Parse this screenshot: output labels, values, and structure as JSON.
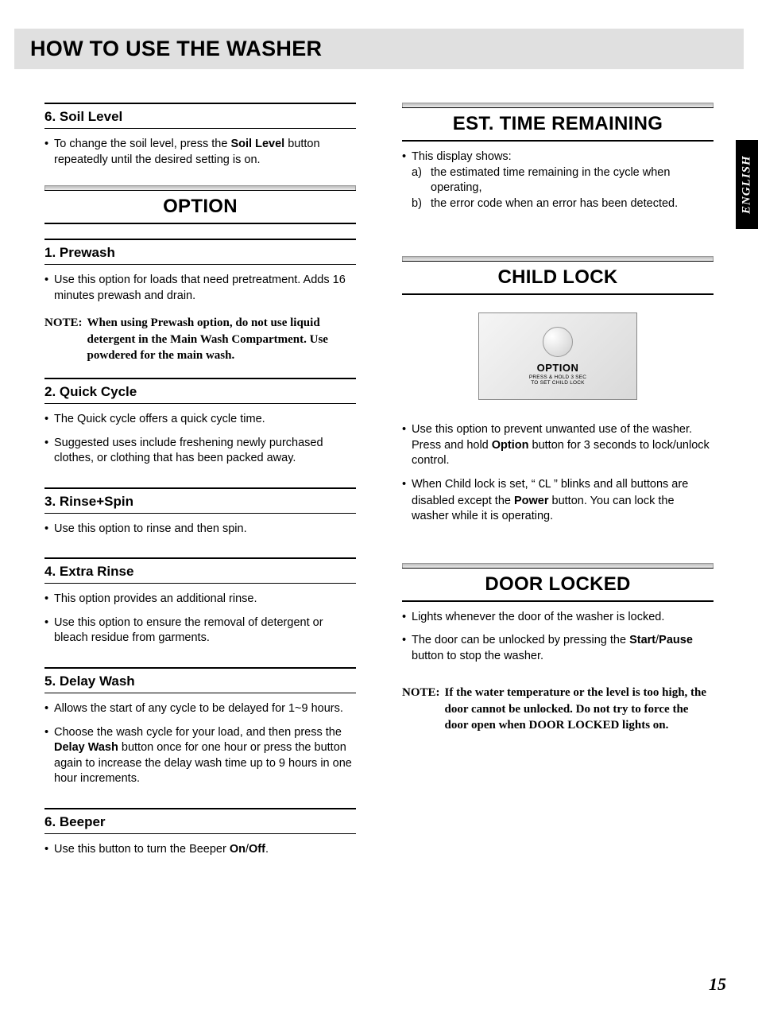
{
  "page_title": "HOW TO USE THE WASHER",
  "lang_tab": "ENGLISH",
  "page_number": "15",
  "left": {
    "soil": {
      "head": "6. Soil Level",
      "b1a": "To change the soil level, press the ",
      "b1b": "Soil Level",
      "b1c": " button repeatedly until the desired setting is on."
    },
    "option_section": "OPTION",
    "prewash": {
      "head": "1. Prewash",
      "b1": "Use this option for loads that need pretreatment. Adds 16 minutes prewash and drain.",
      "note_lbl": "NOTE:",
      "note_body": "When using Prewash option, do not use liquid detergent in the Main Wash Compartment. Use powdered for the main wash."
    },
    "quick": {
      "head": "2. Quick Cycle",
      "b1": "The Quick cycle offers a quick cycle time.",
      "b2": "Suggested uses include freshening newly purchased clothes, or clothing that has been packed away."
    },
    "rinsespin": {
      "head": "3. Rinse+Spin",
      "b1": "Use this option to rinse and then spin."
    },
    "extrarinse": {
      "head": "4. Extra Rinse",
      "b1": "This option provides an additional rinse.",
      "b2": "Use this option to ensure the removal of detergent or bleach residue from garments."
    },
    "delay": {
      "head": "5. Delay Wash",
      "b1": "Allows the start of any cycle to be delayed for 1~9 hours.",
      "b2a": "Choose the wash cycle for your load,  and then press the ",
      "b2b": "Delay Wash",
      "b2c": " button once for one hour or press the button again to increase the delay wash time up to 9 hours in one hour increments."
    },
    "beeper": {
      "head": "6. Beeper",
      "b1a": "Use this button to turn the Beeper ",
      "b1b": "On",
      "b1c": "/",
      "b1d": "Off",
      "b1e": "."
    }
  },
  "right": {
    "est_section": "EST. TIME REMAINING",
    "est": {
      "intro": "This display shows:",
      "a_tag": "a)",
      "a": "the estimated time remaining in the cycle when operating,",
      "b_tag": "b)",
      "b": "the error code when an error has been detected."
    },
    "child_section": "CHILD LOCK",
    "child_graphic": {
      "label": "OPTION",
      "sub1": "PRESS & HOLD 3 SEC",
      "sub2": "TO SET CHILD LOCK"
    },
    "child": {
      "b1a": "Use this option to prevent unwanted use of the washer. Press and hold ",
      "b1b": "Option",
      "b1c": " button for 3 seconds to lock/unlock control.",
      "b2a": "When Child lock is set,  “ ",
      "b2icon": "CL",
      "b2b": " ” blinks and all buttons are disabled except the ",
      "b2c": "Power",
      "b2d": " button. You can lock the washer while it is operating."
    },
    "door_section": "DOOR LOCKED",
    "door": {
      "b1": "Lights whenever the door of  the washer is locked.",
      "b2a": "The door can be unlocked by pressing the ",
      "b2b": "Start",
      "b2c": "/",
      "b2d": "Pause",
      "b2e": " button to stop the washer.",
      "note_lbl": "NOTE:",
      "note_body_a": "If the water temperature or the level is too high, the door cannot be unlocked. Do not try to force the door open when ",
      "note_body_b": "DOOR LOCKED",
      "note_body_c": " lights on."
    }
  }
}
